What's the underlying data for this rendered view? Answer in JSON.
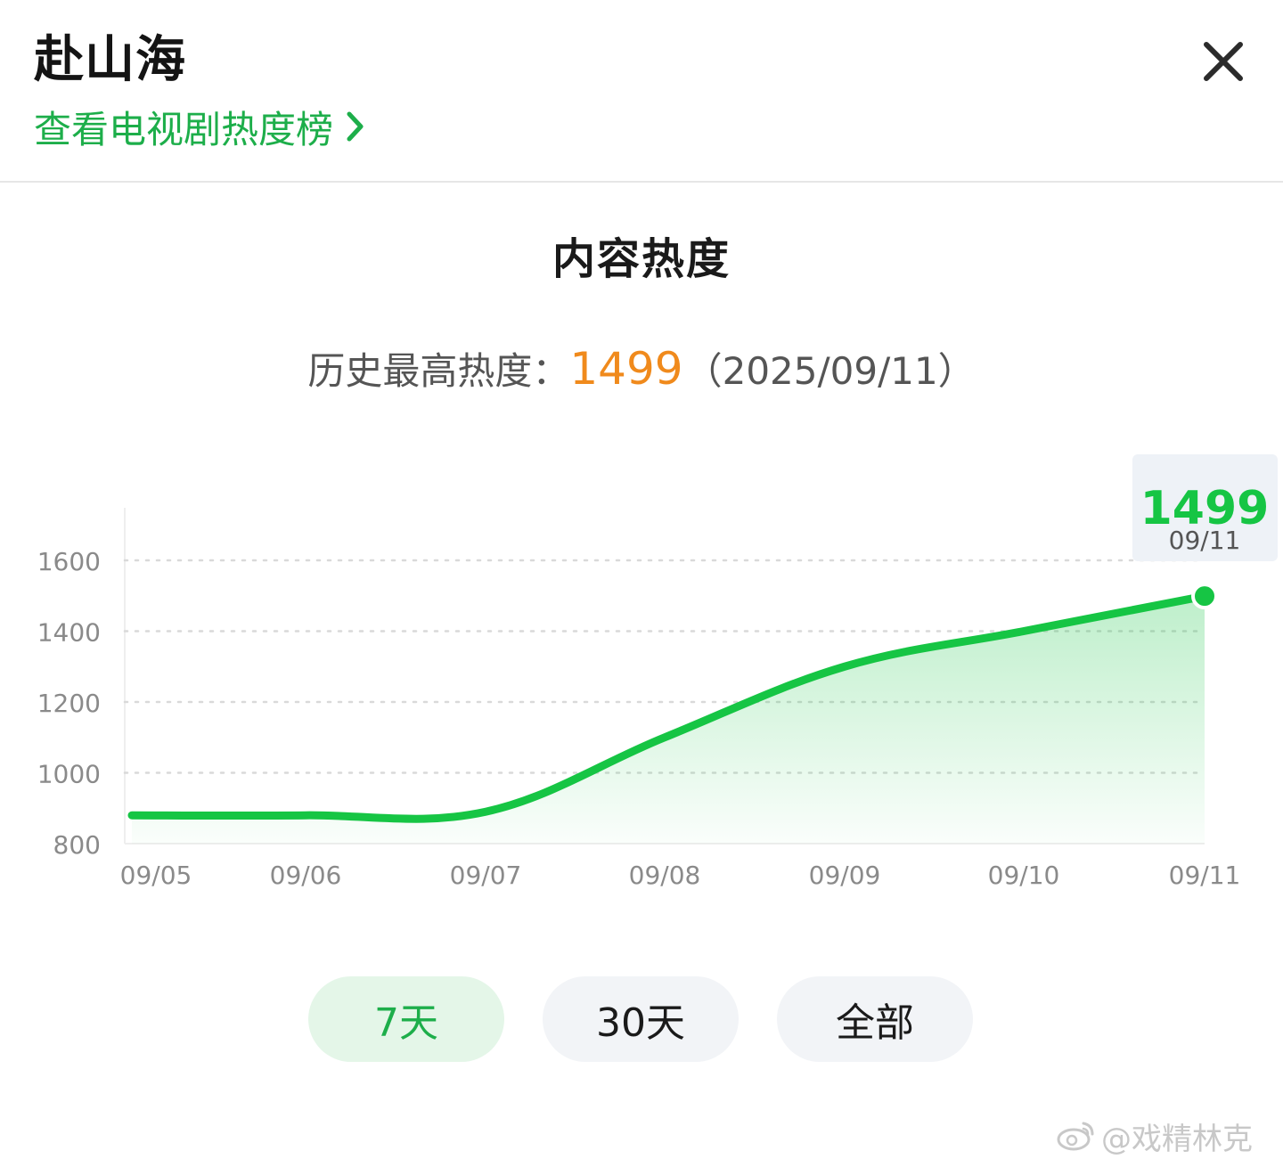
{
  "header": {
    "title": "赴山海",
    "rank_link": "查看电视剧热度榜"
  },
  "section": {
    "title": "内容热度",
    "record_label": "历史最高热度：",
    "record_value": "1499",
    "record_date": "（2025/09/11）"
  },
  "colors": {
    "accent": "#1dae4a",
    "line": "#16c544",
    "peak": "#f08a1c"
  },
  "chart_data": {
    "type": "area",
    "x": [
      "09/05",
      "09/06",
      "09/07",
      "09/08",
      "09/09",
      "09/10",
      "09/11"
    ],
    "series": [
      {
        "values": [
          880,
          880,
          890,
          1100,
          1300,
          1400,
          1499
        ]
      }
    ],
    "yticks": [
      "800",
      "1000",
      "1200",
      "1400",
      "1600"
    ],
    "ylim": [
      800,
      1600
    ],
    "grid": true,
    "tooltip": {
      "value": "1499",
      "date": "09/11"
    }
  },
  "tabs": [
    {
      "label": "7天",
      "active": true
    },
    {
      "label": "30天",
      "active": false
    },
    {
      "label": "全部",
      "active": false
    }
  ],
  "watermark": "@戏精林克"
}
